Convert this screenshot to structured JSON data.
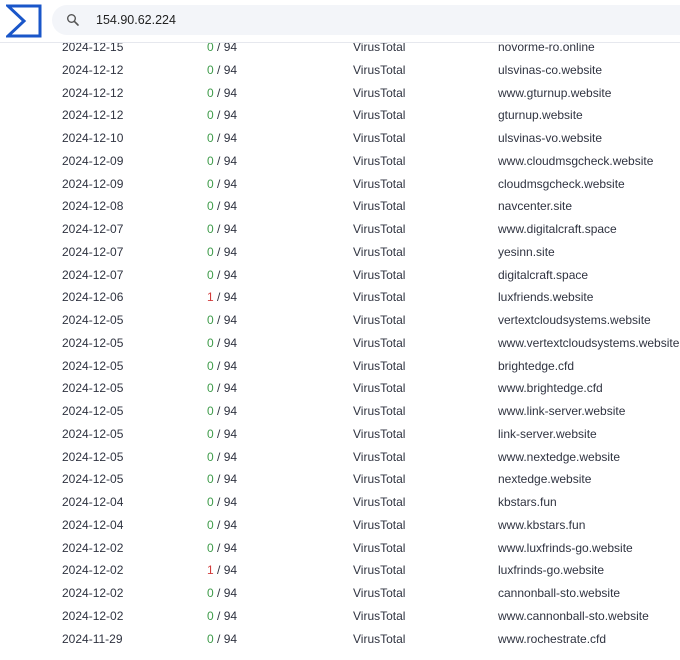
{
  "search": {
    "query": "154.90.62.224"
  },
  "colors": {
    "accent": "#1a56c9",
    "detection_clean": "#3e9b4a",
    "detection_hit": "#d13a3a"
  },
  "rows": [
    {
      "date": "2024-12-15",
      "positives": "0",
      "total": "/ 94",
      "source": "VirusTotal",
      "domain": "novorme-ro.online"
    },
    {
      "date": "2024-12-12",
      "positives": "0",
      "total": "/ 94",
      "source": "VirusTotal",
      "domain": "ulsvinas-co.website"
    },
    {
      "date": "2024-12-12",
      "positives": "0",
      "total": "/ 94",
      "source": "VirusTotal",
      "domain": "www.gturnup.website"
    },
    {
      "date": "2024-12-12",
      "positives": "0",
      "total": "/ 94",
      "source": "VirusTotal",
      "domain": "gturnup.website"
    },
    {
      "date": "2024-12-10",
      "positives": "0",
      "total": "/ 94",
      "source": "VirusTotal",
      "domain": "ulsvinas-vo.website"
    },
    {
      "date": "2024-12-09",
      "positives": "0",
      "total": "/ 94",
      "source": "VirusTotal",
      "domain": "www.cloudmsgcheck.website"
    },
    {
      "date": "2024-12-09",
      "positives": "0",
      "total": "/ 94",
      "source": "VirusTotal",
      "domain": "cloudmsgcheck.website"
    },
    {
      "date": "2024-12-08",
      "positives": "0",
      "total": "/ 94",
      "source": "VirusTotal",
      "domain": "navcenter.site"
    },
    {
      "date": "2024-12-07",
      "positives": "0",
      "total": "/ 94",
      "source": "VirusTotal",
      "domain": "www.digitalcraft.space"
    },
    {
      "date": "2024-12-07",
      "positives": "0",
      "total": "/ 94",
      "source": "VirusTotal",
      "domain": "yesinn.site"
    },
    {
      "date": "2024-12-07",
      "positives": "0",
      "total": "/ 94",
      "source": "VirusTotal",
      "domain": "digitalcraft.space"
    },
    {
      "date": "2024-12-06",
      "positives": "1",
      "total": "/ 94",
      "source": "VirusTotal",
      "domain": "luxfriends.website"
    },
    {
      "date": "2024-12-05",
      "positives": "0",
      "total": "/ 94",
      "source": "VirusTotal",
      "domain": "vertextcloudsystems.website"
    },
    {
      "date": "2024-12-05",
      "positives": "0",
      "total": "/ 94",
      "source": "VirusTotal",
      "domain": "www.vertextcloudsystems.website"
    },
    {
      "date": "2024-12-05",
      "positives": "0",
      "total": "/ 94",
      "source": "VirusTotal",
      "domain": "brightedge.cfd"
    },
    {
      "date": "2024-12-05",
      "positives": "0",
      "total": "/ 94",
      "source": "VirusTotal",
      "domain": "www.brightedge.cfd"
    },
    {
      "date": "2024-12-05",
      "positives": "0",
      "total": "/ 94",
      "source": "VirusTotal",
      "domain": "www.link-server.website"
    },
    {
      "date": "2024-12-05",
      "positives": "0",
      "total": "/ 94",
      "source": "VirusTotal",
      "domain": "link-server.website"
    },
    {
      "date": "2024-12-05",
      "positives": "0",
      "total": "/ 94",
      "source": "VirusTotal",
      "domain": "www.nextedge.website"
    },
    {
      "date": "2024-12-05",
      "positives": "0",
      "total": "/ 94",
      "source": "VirusTotal",
      "domain": "nextedge.website"
    },
    {
      "date": "2024-12-04",
      "positives": "0",
      "total": "/ 94",
      "source": "VirusTotal",
      "domain": "kbstars.fun"
    },
    {
      "date": "2024-12-04",
      "positives": "0",
      "total": "/ 94",
      "source": "VirusTotal",
      "domain": "www.kbstars.fun"
    },
    {
      "date": "2024-12-02",
      "positives": "0",
      "total": "/ 94",
      "source": "VirusTotal",
      "domain": "www.luxfrinds-go.website"
    },
    {
      "date": "2024-12-02",
      "positives": "1",
      "total": "/ 94",
      "source": "VirusTotal",
      "domain": "luxfrinds-go.website"
    },
    {
      "date": "2024-12-02",
      "positives": "0",
      "total": "/ 94",
      "source": "VirusTotal",
      "domain": "cannonball-sto.website"
    },
    {
      "date": "2024-12-02",
      "positives": "0",
      "total": "/ 94",
      "source": "VirusTotal",
      "domain": "www.cannonball-sto.website"
    },
    {
      "date": "2024-11-29",
      "positives": "0",
      "total": "/ 94",
      "source": "VirusTotal",
      "domain": "www.rochestrate.cfd"
    }
  ]
}
